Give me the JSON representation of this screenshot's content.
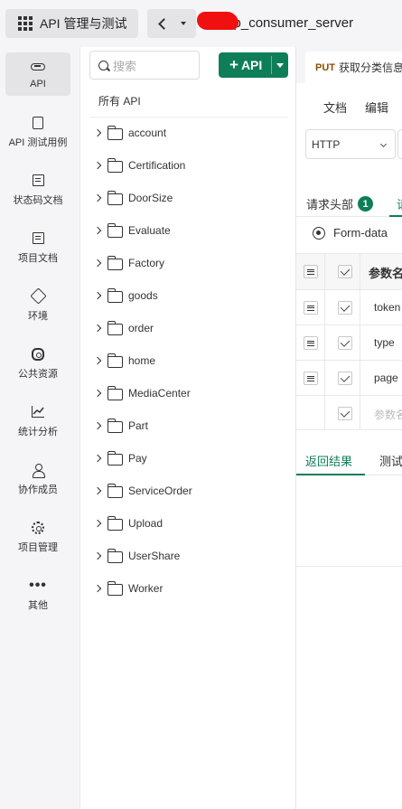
{
  "header": {
    "app_menu_label": "API 管理与测试",
    "project_name": "oshop_consumer_server"
  },
  "nav": [
    {
      "id": "api",
      "label": "API",
      "icon": "link-icon",
      "active": true
    },
    {
      "id": "api-test-cases",
      "label": "API 测试用例",
      "icon": "clipboard-check-icon"
    },
    {
      "id": "status-codes",
      "label": "状态码文档",
      "icon": "document-icon"
    },
    {
      "id": "project-docs",
      "label": "项目文档",
      "icon": "document-list-icon"
    },
    {
      "id": "environment",
      "label": "环境",
      "icon": "cube-icon"
    },
    {
      "id": "public-resources",
      "label": "公共资源",
      "icon": "puzzle-icon"
    },
    {
      "id": "statistics",
      "label": "统计分析",
      "icon": "line-chart-icon"
    },
    {
      "id": "members",
      "label": "协作成员",
      "icon": "user-icon"
    },
    {
      "id": "project-manage",
      "label": "项目管理",
      "icon": "gear-icon"
    },
    {
      "id": "more",
      "label": "其他",
      "icon": "more-dots-icon"
    }
  ],
  "tree": {
    "search_placeholder": "搜索",
    "add_button_label": "API",
    "all_label": "所有 API",
    "folders": [
      "account",
      "Certification",
      "DoorSize",
      "Evaluate",
      "Factory",
      "goods",
      "order",
      "home",
      "MediaCenter",
      "Part",
      "Pay",
      "ServiceOrder",
      "Upload",
      "UserShare",
      "Worker"
    ]
  },
  "editor": {
    "tab": {
      "method": "PUT",
      "title": "获取分类信息"
    },
    "subtabs": [
      "文档",
      "编辑"
    ],
    "protocol": "HTTP",
    "request_tabs": {
      "headers_label": "请求头部",
      "headers_count": "1",
      "next_label": "请"
    },
    "body_type": "Form-data",
    "param_table": {
      "header": "参数名",
      "rows": [
        "token",
        "type",
        "page"
      ],
      "placeholder": "参数名"
    },
    "result_tabs": {
      "active": "返回结果",
      "next": "测试"
    }
  },
  "colors": {
    "accent": "#0e7e59",
    "put_method": "#8a4d00"
  }
}
